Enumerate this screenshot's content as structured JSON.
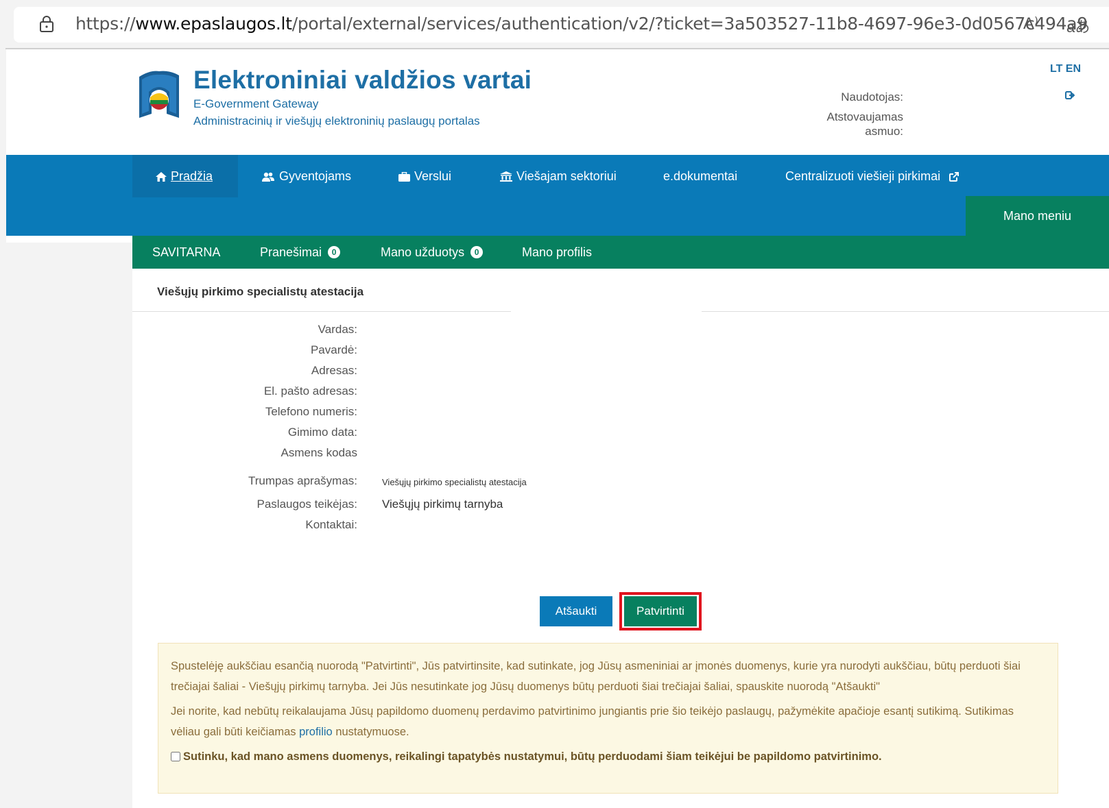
{
  "browser": {
    "url_prefix": "https://",
    "url_domain": "www.epaslaugos.lt",
    "url_path": "/portal/external/services/authentication/v2/?ticket=3a503527-11b8-4697-96e3-0d0567c494a9",
    "read_aloud_glyph": "A⁾",
    "translate_glyph": "aあ"
  },
  "header": {
    "title": "Elektroniniai valdžios vartai",
    "subtitle_en": "E-Government Gateway",
    "subtitle_lt": "Administracinių ir viešųjų elektroninių paslaugų portalas",
    "user_label": "Naudotojas:",
    "represented_label": "Atstovaujamas asmuo:",
    "lang": "LT EN"
  },
  "nav": {
    "items": [
      {
        "label": "Pradžia"
      },
      {
        "label": "Gyventojams"
      },
      {
        "label": "Verslui"
      },
      {
        "label": "Viešajam sektoriui"
      },
      {
        "label": "e.dokumentai"
      },
      {
        "label": "Centralizuoti viešieji pirkimai"
      }
    ],
    "my_menu": "Mano meniu"
  },
  "subnav": {
    "items": [
      {
        "label": "SAVITARNA"
      },
      {
        "label": "Pranešimai",
        "badge": "0"
      },
      {
        "label": "Mano užduotys",
        "badge": "0"
      },
      {
        "label": "Mano profilis"
      }
    ]
  },
  "form": {
    "section_title": "Viešųjų pirkimo specialistų atestacija",
    "fields": [
      {
        "label": "Vardas:",
        "value": ""
      },
      {
        "label": "Pavardė:",
        "value": ""
      },
      {
        "label": "Adresas:",
        "value": ""
      },
      {
        "label": "El. pašto adresas:",
        "value": ""
      },
      {
        "label": "Telefono numeris:",
        "value": ""
      },
      {
        "label": "Gimimo data:",
        "value": ""
      },
      {
        "label": "Asmens kodas",
        "value": ""
      },
      {
        "label": "Trumpas aprašymas:",
        "value": "Viešųjų pirkimo specialistų atestacija"
      },
      {
        "label": "Paslaugos teikėjas:",
        "value": "Viešųjų pirkimų tarnyba"
      },
      {
        "label": "Kontaktai:",
        "value": ""
      }
    ],
    "cancel_label": "Atšaukti",
    "confirm_label": "Patvirtinti"
  },
  "notice": {
    "p1": "Spustelėję aukščiau esančią nuorodą \"Patvirtinti\", Jūs patvirtinsite, kad sutinkate, jog Jūsų asmeniniai ar įmonės duomenys, kurie yra nurodyti aukščiau, būtų perduoti šiai trečiajai šaliai - Viešųjų pirkimų tarnyba. Jei Jūs nesutinkate jog Jūsų duomenys būtų perduoti šiai trečiajai šaliai, spauskite nuorodą \"Atšaukti\"",
    "p2_before": "Jei norite, kad nebūtų reikalaujama Jūsų papildomo duomenų perdavimo patvirtinimo jungiantis prie šio teikėjo paslaugų, pažymėkite apačioje esantį sutikimą. Sutikimas vėliau gali būti keičiamas",
    "p2_link": "profilio",
    "p2_after": "nustatymuose.",
    "consent_label": "Sutinku, kad mano asmens duomenys, reikalingi tapatybės nustatymui, būtų perduodami šiam teikėjui be papildomo patvirtinimo.",
    "consent_checked": false
  }
}
